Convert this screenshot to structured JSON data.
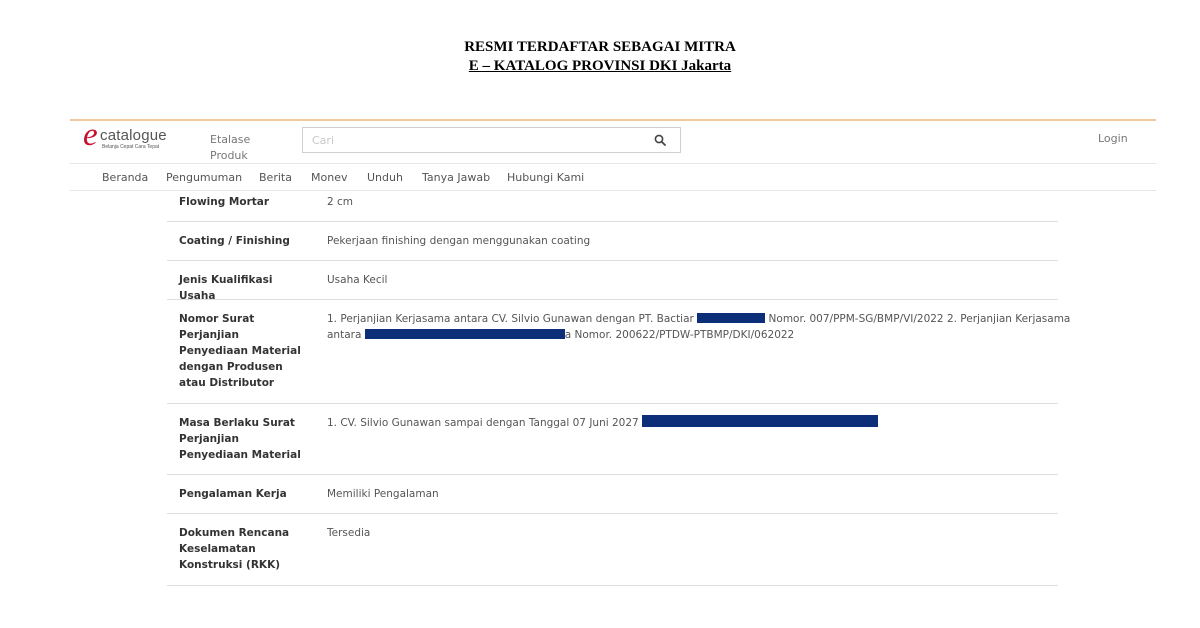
{
  "banner": {
    "line1": "RESMI TERDAFTAR SEBAGAI MITRA",
    "line2": "E – KATALOG PROVINSI DKI Jakarta"
  },
  "header": {
    "logo_e": "e",
    "logo_word": "catalogue",
    "logo_tagline": "Belanja Cepat Cara Tepat",
    "etalase_label": "Etalase Produk",
    "search_placeholder": "Cari",
    "search_icon": "search-icon",
    "login_label": "Login"
  },
  "nav": {
    "items": [
      "Beranda",
      "Pengumuman",
      "Berita",
      "Monev",
      "Unduh",
      "Tanya Jawab",
      "Hubungi Kami"
    ]
  },
  "table": {
    "rows": [
      {
        "label": "Flowing Mortar",
        "value": "2 cm"
      },
      {
        "label": "Coating / Finishing",
        "value": "Pekerjaan finishing dengan menggunakan coating"
      },
      {
        "label": "Jenis Kualifikasi Usaha",
        "value": "Usaha Kecil"
      },
      {
        "label": "Nomor Surat Perjanjian Penyediaan Material dengan Produsen atau Distributor",
        "value_part1": "1. Perjanjian Kerjasama antara CV. Silvio Gunawan dengan PT. Bactiar",
        "value_part2": "Nomor. 007/PPM-SG/BMP/VI/2022 2. Perjanjian Kerjasama",
        "value_part3": "antara",
        "value_part4": "a Nomor. 200622/PTDW-PTBMP/DKI/062022"
      },
      {
        "label": "Masa Berlaku Surat Perjanjian Penyediaan Material",
        "value": "1. CV. Silvio Gunawan sampai dengan Tanggal 07 Juni 2027"
      },
      {
        "label": "Pengalaman Kerja",
        "value": "Memiliki Pengalaman"
      },
      {
        "label": "Dokumen Rencana Keselamatan Konstruksi (RKK)",
        "value": "Tersedia"
      }
    ]
  },
  "colors": {
    "logo_red": "#c8102e",
    "redaction": "#0d2f7a",
    "top_rule": "#f0c8a0"
  }
}
